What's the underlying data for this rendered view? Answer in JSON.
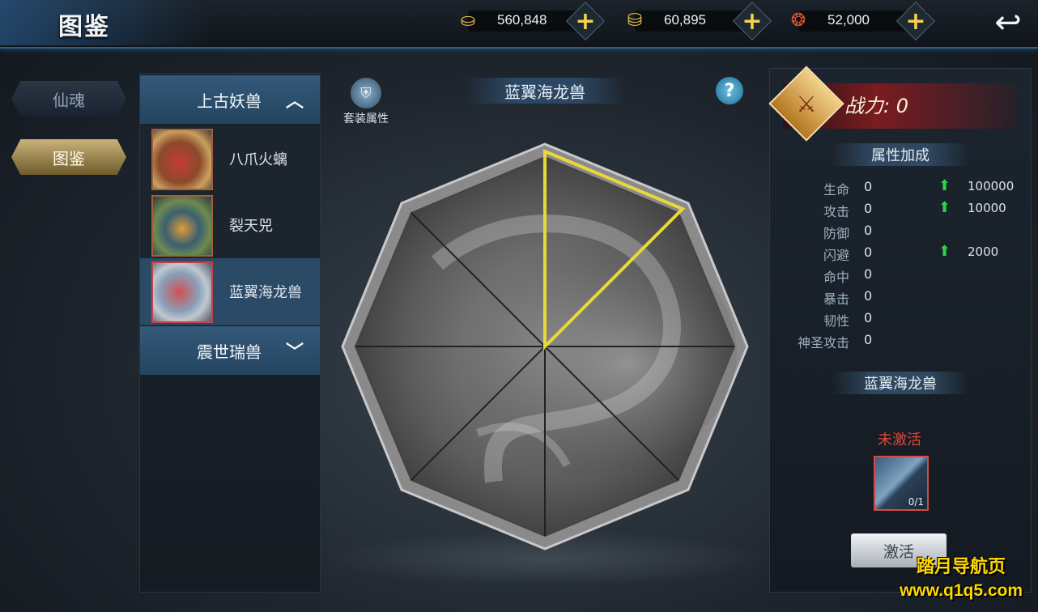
{
  "header": {
    "title": "图鉴",
    "currencies": [
      {
        "icon": "gold-ingot-icon",
        "value": "560,848"
      },
      {
        "icon": "bound-gold-ingot-icon",
        "value": "60,895"
      },
      {
        "icon": "coin-string-icon",
        "value": "52,000"
      }
    ],
    "plus_glyph": "+",
    "back_icon": "back-arrow-icon"
  },
  "side_tabs": [
    {
      "label": "仙魂",
      "active": false
    },
    {
      "label": "图鉴",
      "active": true
    }
  ],
  "beast_list": {
    "categories": [
      {
        "label": "上古妖兽",
        "expanded": true,
        "chevron": "︿"
      },
      {
        "label": "震世瑞兽",
        "expanded": false,
        "chevron": "﹀"
      }
    ],
    "items": [
      {
        "label": "八爪火螭",
        "selected": false
      },
      {
        "label": "裂天兕",
        "selected": false
      },
      {
        "label": "蓝翼海龙兽",
        "selected": true
      }
    ]
  },
  "center": {
    "title": "蓝翼海龙兽",
    "set_attr_label": "套装属性",
    "help_glyph": "?",
    "highlighted_segment": 1
  },
  "right_panel": {
    "power_label": "战力: 0",
    "attr_section_title": "属性加成",
    "attributes": [
      {
        "name": "生命",
        "value": "0",
        "bonus": "100000"
      },
      {
        "name": "攻击",
        "value": "0",
        "bonus": "10000"
      },
      {
        "name": "防御",
        "value": "0",
        "bonus": ""
      },
      {
        "name": "闪避",
        "value": "0",
        "bonus": "2000"
      },
      {
        "name": "命中",
        "value": "0",
        "bonus": ""
      },
      {
        "name": "暴击",
        "value": "0",
        "bonus": ""
      },
      {
        "name": "韧性",
        "value": "0",
        "bonus": ""
      },
      {
        "name": "神圣攻击",
        "value": "0",
        "bonus": ""
      }
    ],
    "beast_section_title": "蓝翼海龙兽",
    "status": "未激活",
    "fragment_count": "0/1",
    "activate_label": "激活"
  },
  "watermark": {
    "line1": "踏月导航页",
    "line2": "www.q1q5.com"
  }
}
